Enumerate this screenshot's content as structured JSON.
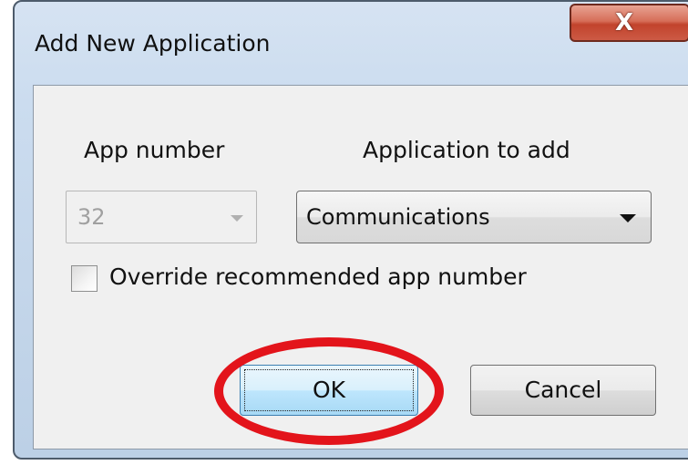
{
  "dialog": {
    "title": "Add New Application",
    "close_glyph": "X",
    "close_icon": "close-icon"
  },
  "form": {
    "app_number_label": "App number",
    "application_label": "Application to add",
    "app_number_value": "32",
    "app_number_enabled": false,
    "application_value": "Communications",
    "override_label": "Override recommended app number",
    "override_checked": false
  },
  "buttons": {
    "ok_label": "OK",
    "cancel_label": "Cancel"
  },
  "annotation": {
    "highlight_color": "#e3141b",
    "highlight_target": "ok-button"
  },
  "colors": {
    "title_close_red": "#c2432c",
    "ok_button_blue": "#bee6fd",
    "frame_blue": "#cbdcef"
  }
}
